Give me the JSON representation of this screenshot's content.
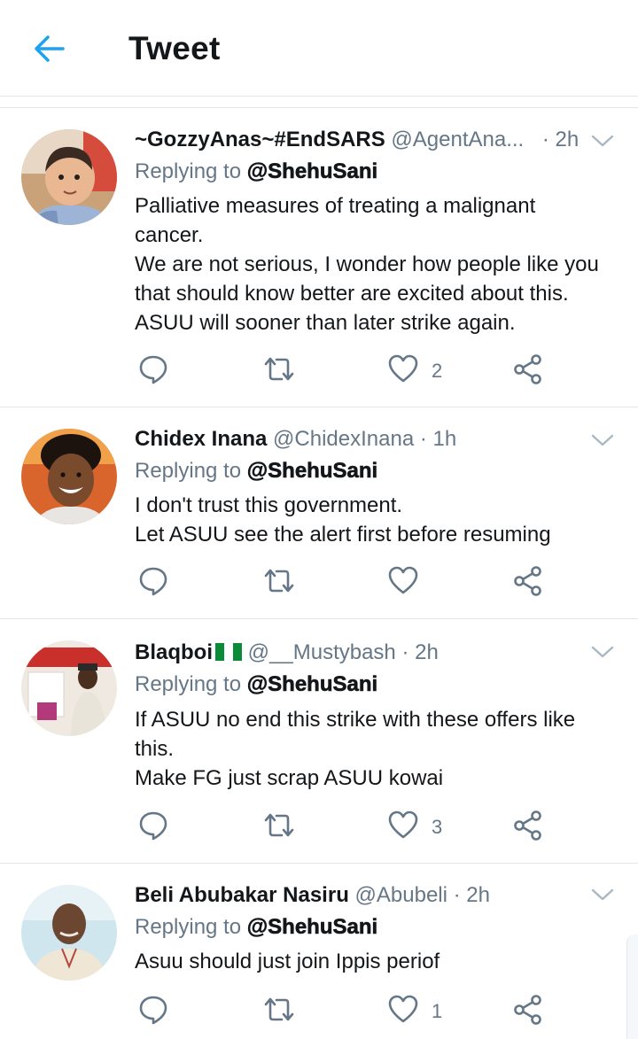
{
  "header": {
    "title": "Tweet"
  },
  "tweets": [
    {
      "name": "~GozzyAnas~#EndSARS",
      "handle": "@AgentAna...",
      "time": "· 2h",
      "replying_prefix": "Replying to",
      "replying_to": "@ShehuSani",
      "lines": [
        "Palliative measures of treating a malignant",
        "cancer.",
        "We are not serious, I wonder how people like you",
        "that should know better are excited about this.",
        "ASUU will sooner than later strike again."
      ],
      "likes": "2"
    },
    {
      "name": "Chidex Inana",
      "handle": "@ChidexInana",
      "time": "· 1h",
      "replying_prefix": "Replying to",
      "replying_to": "@ShehuSani",
      "lines": [
        "I don't trust this government.",
        "Let ASUU see the alert first before resuming"
      ],
      "likes": ""
    },
    {
      "name": "Blaqboi",
      "handle": "@__Mustybash",
      "time": "· 2h",
      "replying_prefix": "Replying to",
      "replying_to": "@ShehuSani",
      "lines": [
        "If ASUU no end this strike with these offers like",
        "this.",
        "Make FG just scrap ASUU kowai"
      ],
      "likes": "3"
    },
    {
      "name": "Beli Abubakar Nasiru",
      "handle": "@Abubeli",
      "time": "· 2h",
      "replying_prefix": "Replying to",
      "replying_to": "@ShehuSani",
      "lines": [
        "Asuu should just join Ippis periof"
      ],
      "likes": "1"
    }
  ],
  "colors": {
    "accent": "#1da1f2",
    "icon": "#657786",
    "divider": "#e1e8ed",
    "text": "#14171a"
  },
  "icons": [
    "back-arrow-icon",
    "reply-icon",
    "retweet-icon",
    "like-icon",
    "share-icon",
    "chevron-down-icon",
    "nigeria-flag-icon"
  ]
}
